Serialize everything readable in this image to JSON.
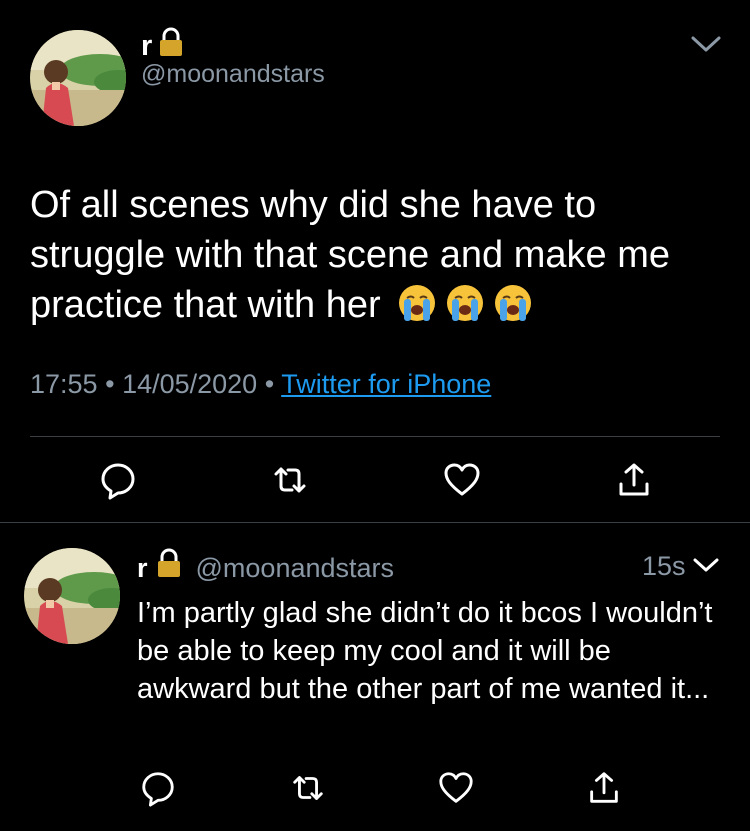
{
  "main_tweet": {
    "display_name": "r",
    "handle": "@moonandstars",
    "text": "Of all scenes why did she have to struggle with that scene and make me practice that with her",
    "emoji_icons": [
      "loudly-crying-face-icon",
      "loudly-crying-face-icon",
      "loudly-crying-face-icon"
    ],
    "time": "17:55",
    "separator": "•",
    "date": "14/05/2020",
    "source": "Twitter for iPhone"
  },
  "reply_tweet": {
    "display_name": "r",
    "handle": "@moonandstars",
    "time_ago": "15s",
    "text": "I’m partly glad she didn’t do it bcos I wouldn’t be able to keep my cool and it will be awkward but the other part of me wanted it..."
  },
  "icons": {
    "lock": "lock-icon",
    "chevron": "chevron-down-icon",
    "reply": "reply-icon",
    "retweet": "retweet-icon",
    "like": "heart-icon",
    "share": "share-icon"
  },
  "colors": {
    "background": "#000000",
    "text": "#ffffff",
    "secondary": "#8b98a5",
    "link": "#1d9bf0",
    "divider": "#3a3f44",
    "lock": "#d4a52a"
  }
}
